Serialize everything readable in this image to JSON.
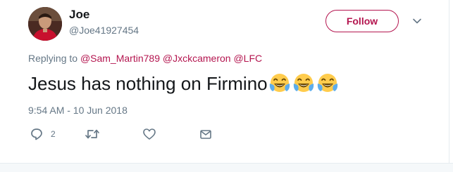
{
  "user": {
    "display_name": "Joe",
    "handle": "@Joe41927454"
  },
  "follow_button": {
    "label": "Follow"
  },
  "reply_context": {
    "prefix": "Replying to",
    "mentions": [
      "@Sam_Martin789",
      "@Jxckcameron",
      "@LFC"
    ]
  },
  "tweet": {
    "text": "Jesus has nothing on Firmino",
    "emojis": [
      "face-with-tears-of-joy",
      "face-with-tears-of-joy",
      "face-with-tears-of-joy"
    ]
  },
  "timestamp": "9:54 AM - 10 Jun 2018",
  "actions": {
    "reply_count": "2",
    "icons": [
      "reply-icon",
      "retweet-icon",
      "like-icon",
      "direct-message-icon"
    ]
  },
  "colors": {
    "accent": "#b4154f",
    "text": "#14171a",
    "muted": "#657786"
  }
}
